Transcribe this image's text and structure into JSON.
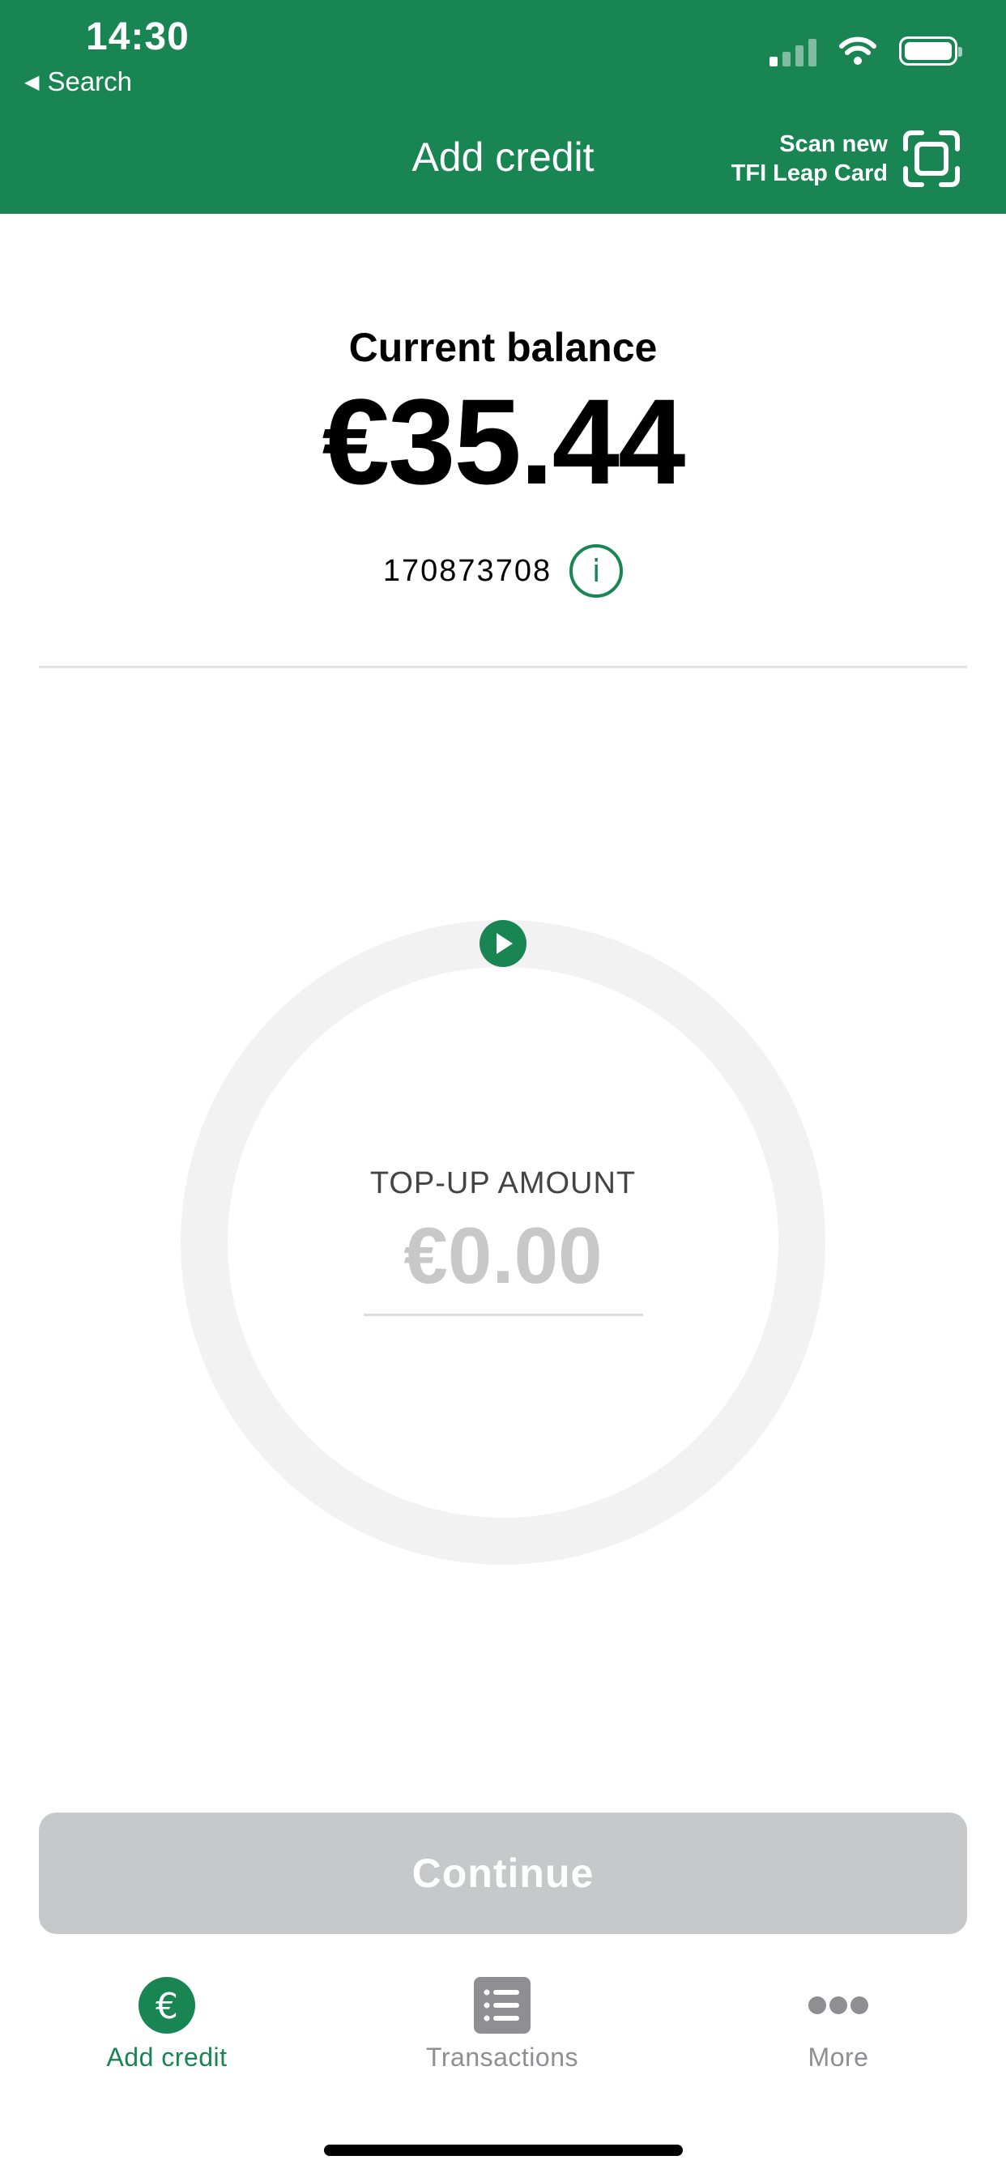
{
  "status_bar": {
    "time": "14:30",
    "back_label": "Search"
  },
  "header": {
    "title": "Add credit",
    "scan_line1": "Scan new",
    "scan_line2": "TFI Leap Card",
    "background_color": "#188553"
  },
  "balance": {
    "label": "Current balance",
    "amount": "€35.44",
    "card_number": "170873708"
  },
  "topup": {
    "label": "TOP-UP AMOUNT",
    "amount": "€0.00",
    "dial_progress": 0
  },
  "continue_button": {
    "label": "Continue",
    "enabled": false
  },
  "tabs": [
    {
      "label": "Add credit",
      "icon": "euro-icon",
      "active": true
    },
    {
      "label": "Transactions",
      "icon": "list-icon",
      "active": false
    },
    {
      "label": "More",
      "icon": "more-dots-icon",
      "active": false
    }
  ],
  "colors": {
    "accent": "#188553",
    "disabled_button": "#c6c8ca",
    "inactive_tab": "#8e8e93"
  }
}
